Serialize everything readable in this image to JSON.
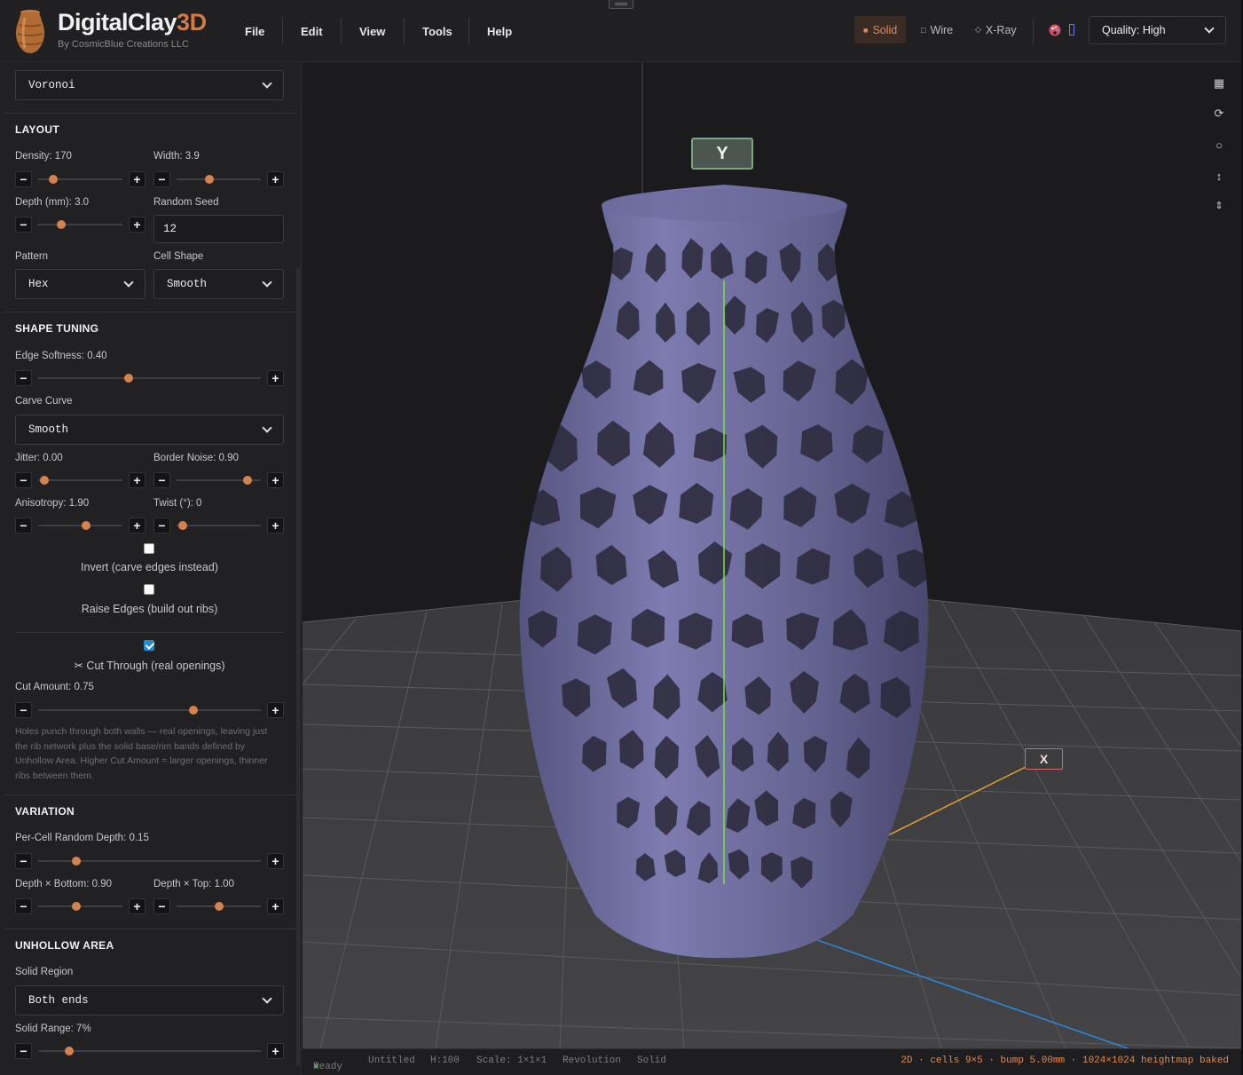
{
  "app": {
    "name": "DigitalClay",
    "name_accent": "3D",
    "subtitle": "By CosmicBlue Creations LLC"
  },
  "menu": [
    "File",
    "Edit",
    "View",
    "Tools",
    "Help"
  ],
  "view_modes": [
    {
      "label": "Solid",
      "icon": "square-filled-icon",
      "active": true
    },
    {
      "label": "Wire",
      "icon": "square-outline-icon",
      "active": false
    },
    {
      "label": "X-Ray",
      "icon": "diamond-icon",
      "active": false
    }
  ],
  "quality": {
    "value": "Quality: High"
  },
  "sidebar": {
    "top_select": "Voronoi",
    "layout": {
      "title": "LAYOUT",
      "density": {
        "label": "Density: 170",
        "value": 0.12
      },
      "width": {
        "label": "Width: 3.9",
        "value": 0.37
      },
      "depth": {
        "label": "Depth (mm): 3.0",
        "value": 0.24
      },
      "seed_label": "Random Seed",
      "seed_value": "12",
      "pattern_label": "Pattern",
      "pattern_value": "Hex",
      "cell_shape_label": "Cell Shape",
      "cell_shape_value": "Smooth"
    },
    "shape_tuning": {
      "title": "SHAPE TUNING",
      "edge_softness": {
        "label": "Edge Softness: 0.40",
        "value": 0.4
      },
      "carve_curve_label": "Carve Curve",
      "carve_curve_value": "Smooth",
      "jitter": {
        "label": "Jitter: 0.00",
        "value": 0.0
      },
      "border_noise": {
        "label": "Border Noise: 0.90",
        "value": 0.9
      },
      "anisotropy": {
        "label": "Anisotropy: 1.90",
        "value": 0.58
      },
      "twist": {
        "label": "Twist (°): 0",
        "value": 0.0
      },
      "invert_label": "Invert (carve edges instead)",
      "invert_checked": false,
      "raise_label": "Raise Edges (build out ribs)",
      "raise_checked": false,
      "cut_label": "Cut Through (real openings)",
      "cut_checked": true,
      "cut_amount": {
        "label": "Cut Amount: 0.75",
        "value": 0.71
      },
      "help_text": "Holes punch through both walls — real openings, leaving just the rib network plus the solid base/rim bands defined by Unhollow Area. Higher Cut Amount = larger openings, thinner ribs between them."
    },
    "variation": {
      "title": "VARIATION",
      "per_cell": {
        "label": "Per-Cell Random Depth: 0.15",
        "value": 0.15
      },
      "depth_bottom": {
        "label": "Depth × Bottom: 0.90",
        "value": 0.45
      },
      "depth_top": {
        "label": "Depth × Top: 1.00",
        "value": 0.5
      }
    },
    "unhollow": {
      "title": "UNHOLLOW AREA",
      "solid_region_label": "Solid Region",
      "solid_region_value": "Both ends",
      "solid_range": {
        "label": "Solid Range: 7%",
        "value": 0.12
      }
    }
  },
  "viewport": {
    "y_axis_label": "Y",
    "x_axis_label": "X",
    "model_color": "#6a6897"
  },
  "toolbar_icons": [
    "grid-icon",
    "reset-rotation-icon",
    "sphere-icon",
    "vertical-arrows-icon",
    "align-center-icon"
  ],
  "status": {
    "ready": "Ready",
    "file": "Untitled",
    "height": "H:100",
    "scale": "Scale: 1×1×1",
    "mode": "Revolution",
    "render": "Solid",
    "summary": "2D · cells 9×5 · bump 5.00mm · 1024×1024 heightmap baked"
  }
}
